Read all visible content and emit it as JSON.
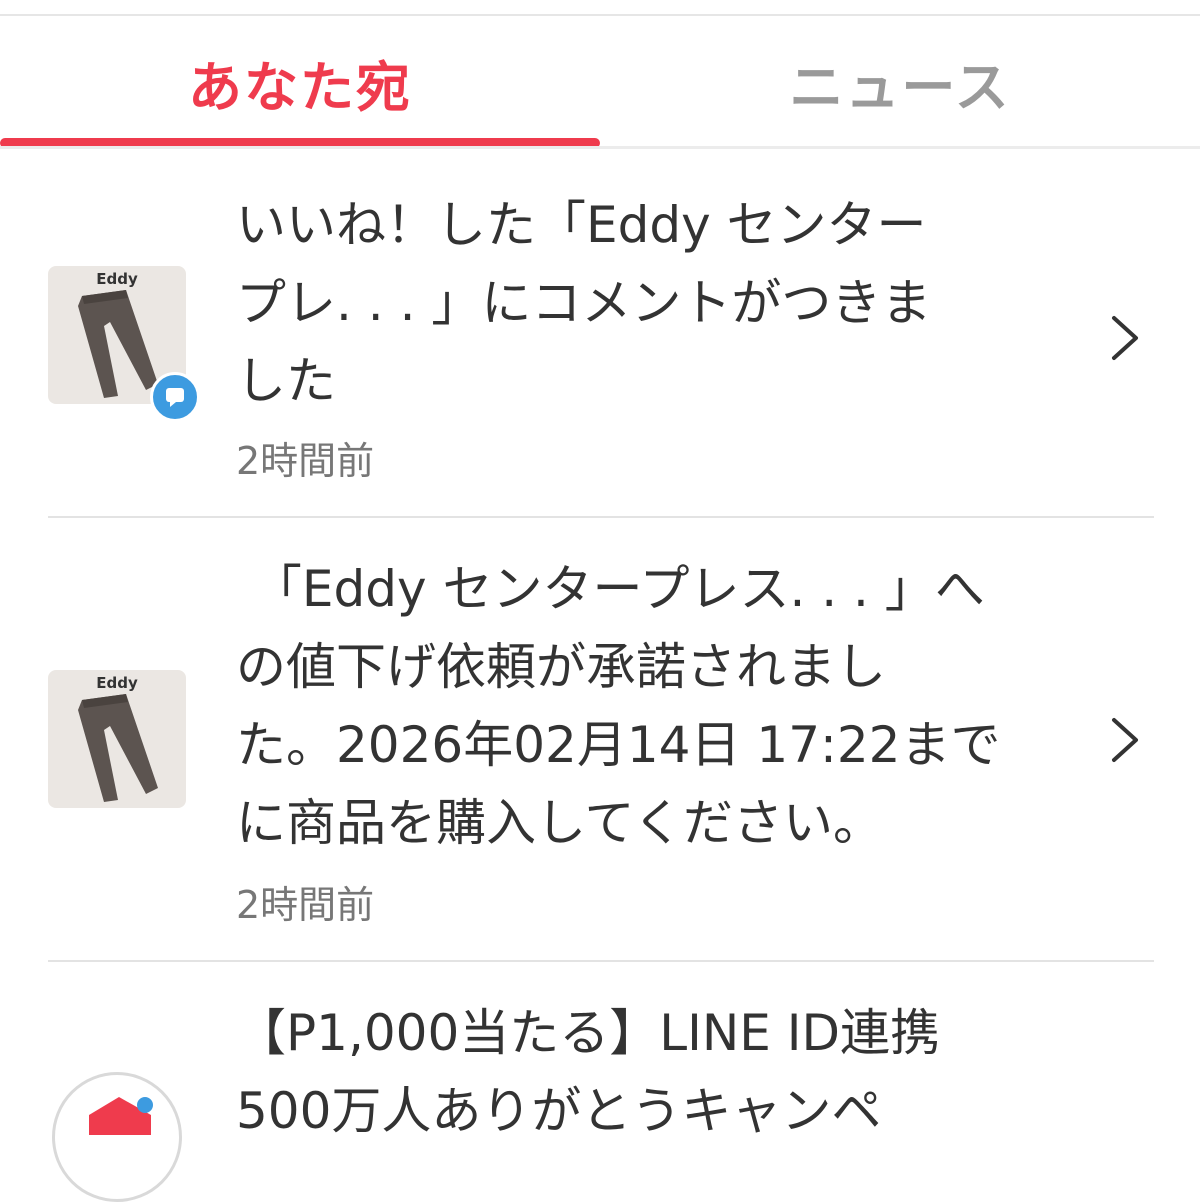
{
  "tabs": [
    {
      "label": "あなた宛",
      "active": true
    },
    {
      "label": "ニュース",
      "active": false
    }
  ],
  "colors": {
    "accent": "#ef3b4d",
    "inactive_tab": "#9a9a9a",
    "badge": "#3d9be0"
  },
  "notifications": [
    {
      "thumb_label": "Eddy",
      "message_lines": [
        "いいね！した「Eddy センター",
        "プレ. . . 」にコメントがつきま",
        "した"
      ],
      "time": "2時間前",
      "badge_icon": "comment-badge-icon"
    },
    {
      "thumb_label": "Eddy",
      "message_lines": [
        " 「Eddy センタープレス. . . 」へ",
        "の値下げ依頼が承諾されまし",
        "た。2026年02月14日 17:22まで",
        "に商品を購入してください。"
      ],
      "time": "2時間前"
    },
    {
      "message_lines": [
        "【P1,000当たる】LINE ID連携",
        "500万人ありがとうキャンペ"
      ]
    }
  ]
}
